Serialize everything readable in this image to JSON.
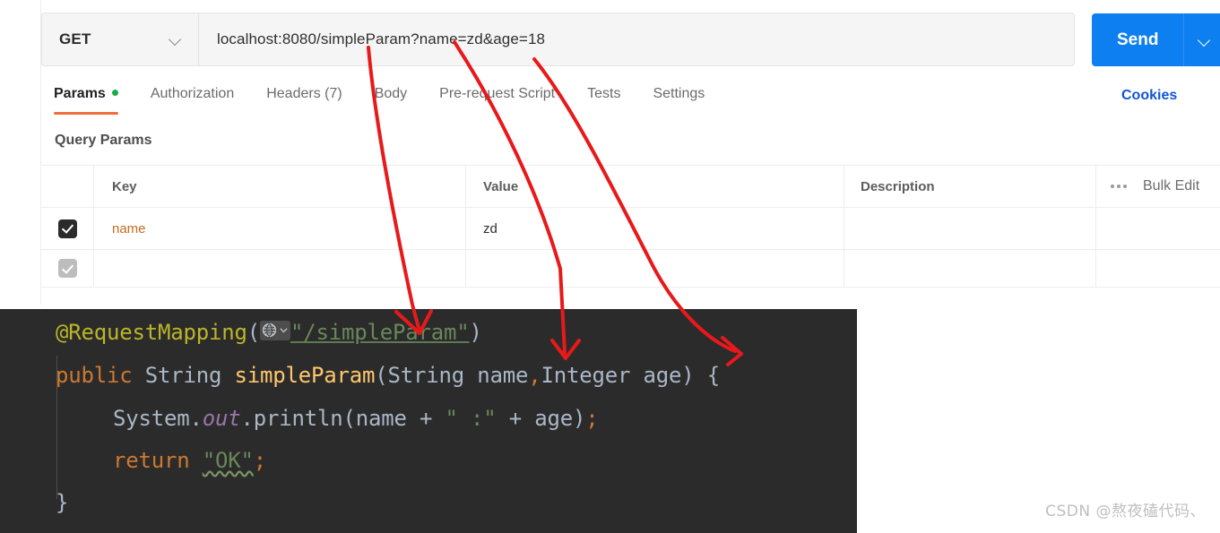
{
  "request": {
    "method": "GET",
    "url": "localhost:8080/simpleParam?name=zd&age=18",
    "send_label": "Send",
    "method_caret_icon": "chevron-down-icon",
    "send_caret_icon": "chevron-down-icon"
  },
  "tabs": [
    {
      "label": "Params",
      "active": true,
      "dot": true
    },
    {
      "label": "Authorization",
      "active": false,
      "dot": false
    },
    {
      "label": "Headers (7)",
      "active": false,
      "dot": false
    },
    {
      "label": "Body",
      "active": false,
      "dot": false
    },
    {
      "label": "Pre-request Script",
      "active": false,
      "dot": false
    },
    {
      "label": "Tests",
      "active": false,
      "dot": false
    },
    {
      "label": "Settings",
      "active": false,
      "dot": false
    }
  ],
  "cookies_link": "Cookies",
  "params": {
    "section_title": "Query Params",
    "columns": {
      "key": "Key",
      "value": "Value",
      "description": "Description"
    },
    "tools": {
      "more_icon": "ellipsis-icon",
      "bulk_edit": "Bulk Edit"
    },
    "rows": [
      {
        "checked": true,
        "key": "name",
        "value": "zd",
        "description": ""
      },
      {
        "checked": false,
        "key": "",
        "value": "",
        "description": ""
      }
    ]
  },
  "code": {
    "line1": {
      "annotation": "@RequestMapping",
      "open_paren": "(",
      "gutter_icon": "globe-icon",
      "gutter_caret_icon": "chevron-down-icon",
      "string": "\"/simpleParam\"",
      "close_paren": ")"
    },
    "line2": {
      "kw_public": "public",
      "type_string": " String ",
      "method": "simpleParam",
      "sig_a": "(String name",
      "comma": ",",
      "sig_b": "Integer age) {"
    },
    "line3": {
      "a": "System.",
      "static_out": "out",
      "b": ".println(name + ",
      "str": "\" :\"",
      "c": " + age)",
      "semi": ";"
    },
    "line4": {
      "kw_return": "return",
      "str": "\"OK\"",
      "semi": ";"
    },
    "line5": {
      "close_brace": "}"
    }
  },
  "watermark": "CSDN @熬夜磕代码、",
  "colors": {
    "accent_orange": "#f26b3a",
    "send_blue": "#0d7ff0",
    "link_blue": "#1254d8",
    "status_green": "#1dab4a",
    "annotation_red": "#e8191b",
    "editor_bg": "#2b2b2b"
  }
}
